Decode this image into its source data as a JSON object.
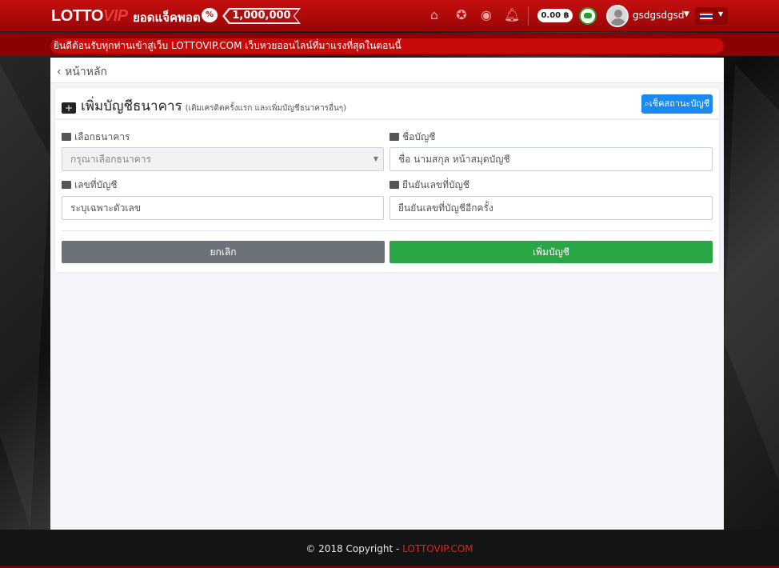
{
  "header": {
    "logo_main": "LOTTO",
    "logo_accent": "VIP",
    "jackpot_label": "ยอดแจ็คพอต",
    "jackpot_value": "1,000,000",
    "credit": "0.00 ฿",
    "username": "gsdgsdgsd"
  },
  "marquee": {
    "text": "ยินดีต้อนรับทุกท่านเข้าสู่เว็บ LOTTOVIP.COM เว็บหวยออนไลน์ที่มาแรงที่สุดในตอนนี้"
  },
  "nav": {
    "back_label": "หน้าหลัก"
  },
  "form": {
    "title": "เพิ่มบัญชีธนาคาร",
    "subtitle": "(เติมเครดิตครั้งแรก และเพิ่มบัญชีธนาคารอื่นๆ)",
    "check_button": "เช็คสถานะบัญชี",
    "bank_label": "เลือกธนาคาร",
    "bank_placeholder": "กรุณาเลือกธนาคาร",
    "name_label": "ชื่อบัญชี",
    "name_placeholder": "ชื่อ นามสกุล หน้าสมุดบัญชี",
    "number_label": "เลขที่บัญชี",
    "number_placeholder": "ระบุเฉพาะตัวเลข",
    "confirm_label": "ยืนยันเลขที่บัญชี",
    "confirm_placeholder": "ยืนยันเลขที่บัญชีอีกครั้ง",
    "cancel_button": "ยกเลิก",
    "submit_button": "เพิ่มบัญชี"
  },
  "footer": {
    "copyright": "© 2018 Copyright - ",
    "brand": "LOTTOVIP.COM"
  },
  "colors": {
    "header_red": "#c40f0f",
    "primary_blue": "#1a8af0",
    "success_green": "#2aa745",
    "cancel_gray": "#6c7378"
  },
  "icons": [
    "home-icon",
    "award-icon",
    "user-circle-icon",
    "bell-icon",
    "chat-icon",
    "plus-square-icon",
    "search-icon",
    "bank-icon",
    "id-card-icon",
    "check-square-icon",
    "double-check-icon"
  ]
}
